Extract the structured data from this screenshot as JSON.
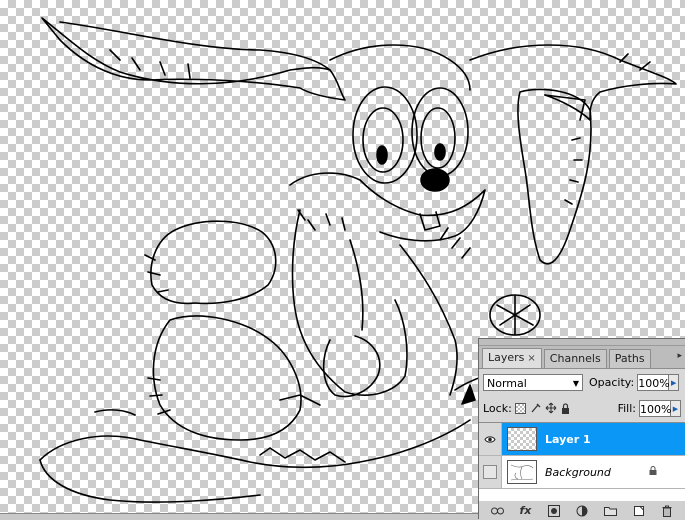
{
  "panel": {
    "tabs": [
      {
        "label": "Layers",
        "active": true
      },
      {
        "label": "Channels",
        "active": false
      },
      {
        "label": "Paths",
        "active": false
      }
    ],
    "close_glyph": "×",
    "menu_glyph": "▸",
    "blend_mode": "Normal",
    "opacity_label": "Opacity:",
    "opacity_value": "100%",
    "lock_label": "Lock:",
    "fill_label": "Fill:",
    "fill_value": "100%",
    "layers": [
      {
        "name": "Layer 1",
        "selected": true,
        "visible": true
      },
      {
        "name": "Background",
        "selected": false,
        "visible": false,
        "locked": true
      }
    ],
    "bottom_icons": [
      "link-icon",
      "fx-icon",
      "mask-icon",
      "adjustment-icon",
      "group-folder-icon",
      "new-layer-icon",
      "trash-icon"
    ],
    "fx_label": "fx"
  },
  "colors": {
    "selection": "#0a97f5",
    "panel_bg": "#d8d8d8",
    "checker": "#cccccc",
    "ink": "#000000"
  }
}
